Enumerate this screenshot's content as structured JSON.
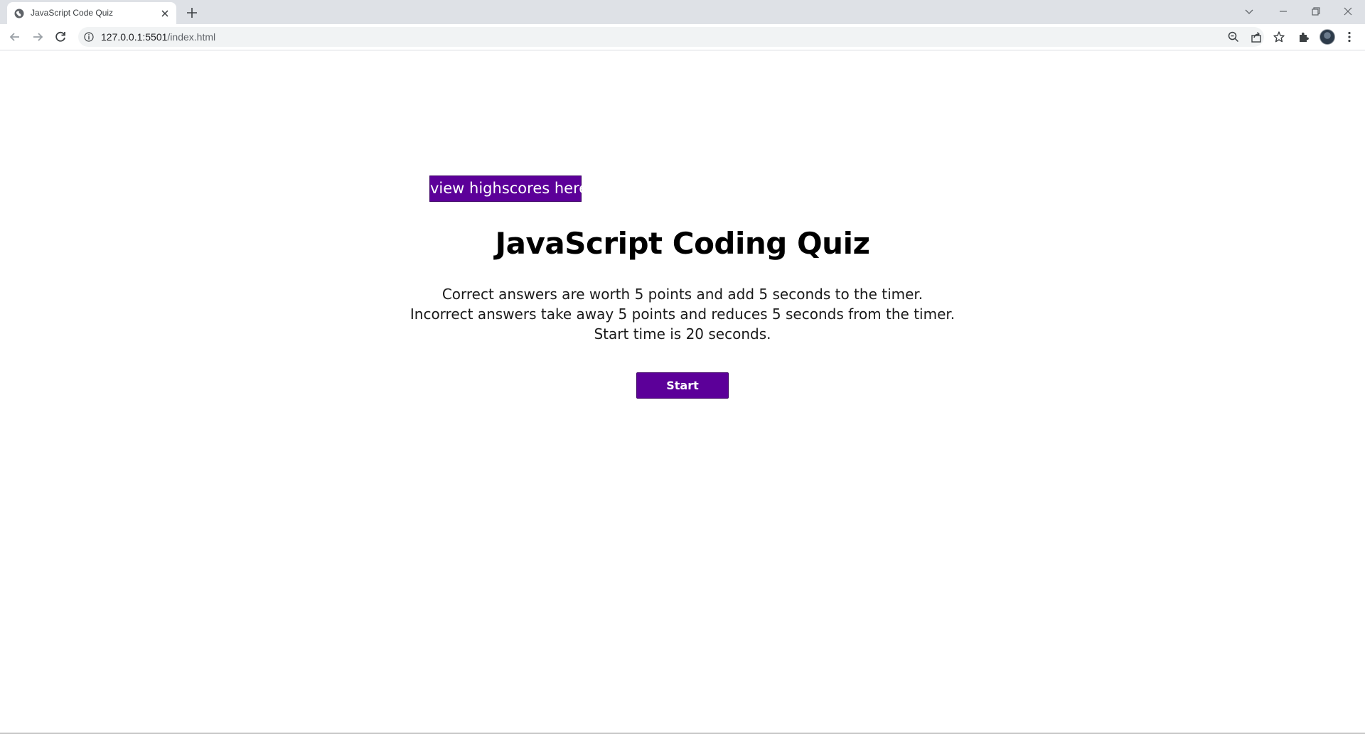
{
  "browser": {
    "tab_title": "JavaScript Code Quiz",
    "url_host": "127.0.0.1:5501",
    "url_path": "/index.html",
    "icons": {
      "favicon": "globe-icon",
      "tab_close": "close-icon",
      "new_tab": "plus-icon",
      "back": "arrow-left-icon",
      "forward": "arrow-right-icon",
      "reload": "reload-icon",
      "site_info": "info-icon",
      "zoom": "zoom-icon",
      "share": "share-icon",
      "bookmark": "star-icon",
      "extensions": "puzzle-icon",
      "menu": "kebab-menu-icon"
    }
  },
  "page": {
    "highscores_label": "view highscores here",
    "title": "JavaScript Coding Quiz",
    "instructions": [
      "Correct answers are worth 5 points and add 5 seconds to the timer.",
      "Incorrect answers take away 5 points and reduces 5 seconds from the timer.",
      "Start time is 20 seconds."
    ],
    "start_label": "Start"
  },
  "colors": {
    "button_bg": "#5c0099",
    "button_text": "#ffffff",
    "tabstrip_bg": "#dee1e6",
    "omnibox_bg": "#f1f3f4"
  }
}
